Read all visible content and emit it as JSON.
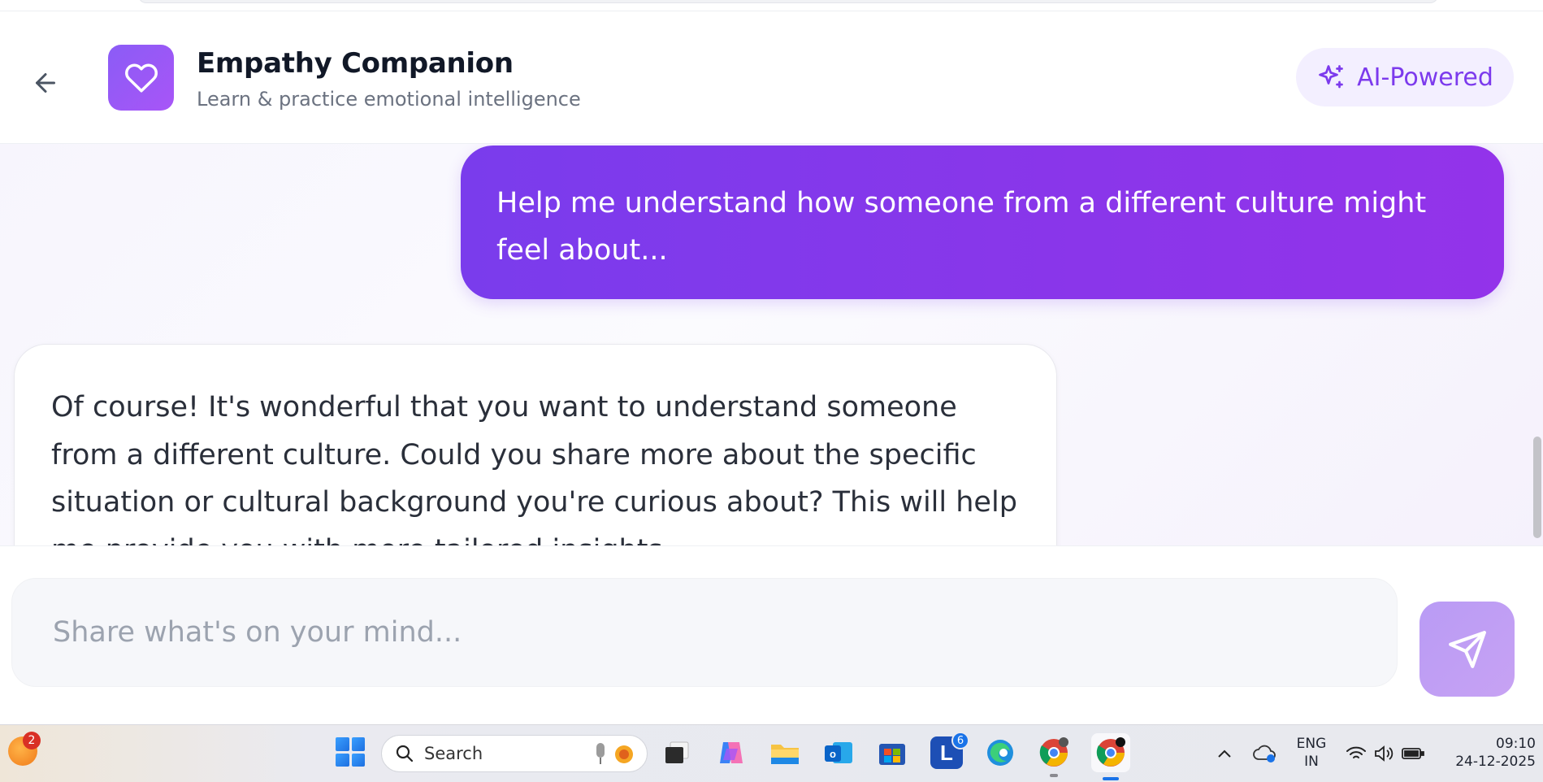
{
  "header": {
    "title": "Empathy Companion",
    "subtitle": "Learn & practice emotional intelligence",
    "badge_label": "AI-Powered",
    "back_icon": "arrow-left-icon",
    "logo_icon": "heart-icon",
    "badge_icon": "sparkles-icon"
  },
  "messages": [
    {
      "role": "user",
      "text": "Help me understand how someone from a different culture might feel about..."
    },
    {
      "role": "assistant",
      "text": "Of course! It's wonderful that you want to understand someone from a different culture. Could you share more about the specific situation or cultural background you're curious about? This will help me provide you with more tailored insights."
    }
  ],
  "composer": {
    "placeholder": "Share what's on your mind...",
    "value": "",
    "send_icon": "send-icon"
  },
  "colors": {
    "accent": "#8b5cf6",
    "user_bubble": "#8a36ea",
    "send_button": "#c0a0f4"
  },
  "taskbar": {
    "widget_badge": "2",
    "search_label": "Search",
    "apps": [
      {
        "name": "task-view-icon"
      },
      {
        "name": "copilot-icon"
      },
      {
        "name": "file-explorer-icon"
      },
      {
        "name": "outlook-icon"
      },
      {
        "name": "microsoft-store-icon"
      },
      {
        "name": "l-app-icon",
        "badge": "6"
      },
      {
        "name": "edge-icon"
      },
      {
        "name": "chrome-icon"
      },
      {
        "name": "chrome-icon"
      }
    ],
    "tray": {
      "lang_line1": "ENG",
      "lang_line2": "IN",
      "time": "09:10",
      "date": "24-12-2025"
    }
  }
}
